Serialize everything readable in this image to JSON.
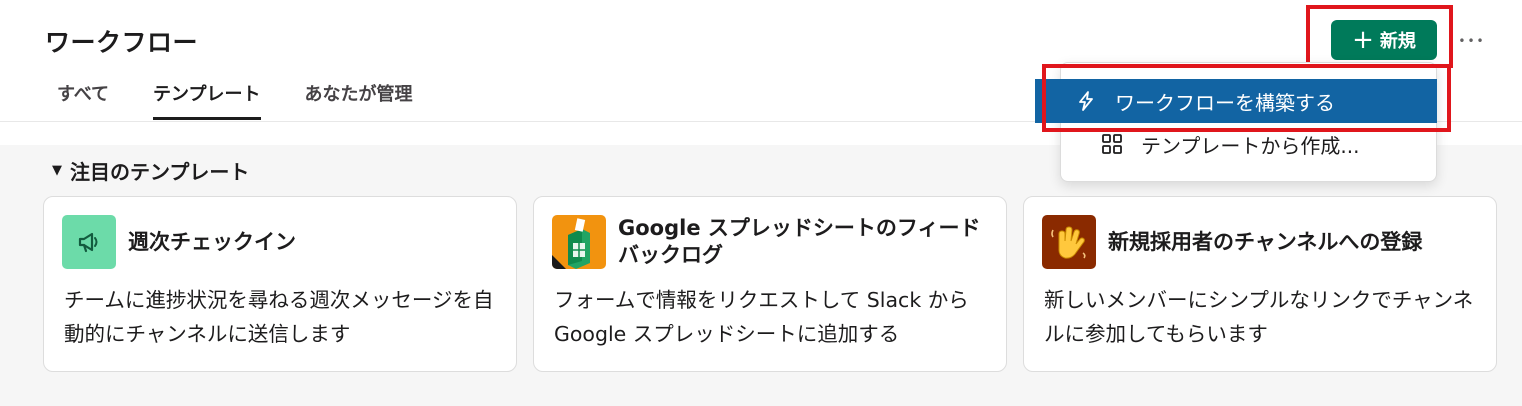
{
  "header": {
    "title": "ワークフロー",
    "tabs": [
      {
        "label": "すべて",
        "active": false
      },
      {
        "label": "テンプレート",
        "active": true
      },
      {
        "label": "あなたが管理",
        "active": false
      }
    ],
    "new_button": {
      "icon": "plus-icon",
      "label": "新規",
      "color": "#007a5a"
    },
    "more_button": {
      "icon": "more-horizontal-icon",
      "label": "•••"
    }
  },
  "dropdown": {
    "items": [
      {
        "icon": "lightning-icon",
        "label": "ワークフローを構築する",
        "highlighted": true
      },
      {
        "icon": "grid-icon",
        "label": "テンプレートから作成..."
      }
    ]
  },
  "section": {
    "caret": "▼",
    "title": "注目のテンプレート"
  },
  "cards": [
    {
      "icon": "megaphone-icon",
      "title": "週次チェックイン",
      "description": "チームに進捗状況を尋ねる週次メッセージを自動的にチャンネルに送信します",
      "icon_bg": "#6cdba9"
    },
    {
      "icon": "google-sheets-form-icon",
      "title": "Google スプレッドシートのフィードバックログ",
      "description": "フォームで情報をリクエストして Slack から Google スプレッドシートに追加する",
      "icon_bg": "#f2930f"
    },
    {
      "icon": "waving-hand-icon",
      "title": "新規採用者のチャンネルへの登録",
      "description": "新しいメンバーにシンプルなリンクでチャンネルに参加してもらいます",
      "icon_bg": "#8a2a00"
    }
  ],
  "colors": {
    "highlight_border": "#e0161c",
    "menu_selected": "#1264a3",
    "content_bg": "#f6f6f6"
  }
}
